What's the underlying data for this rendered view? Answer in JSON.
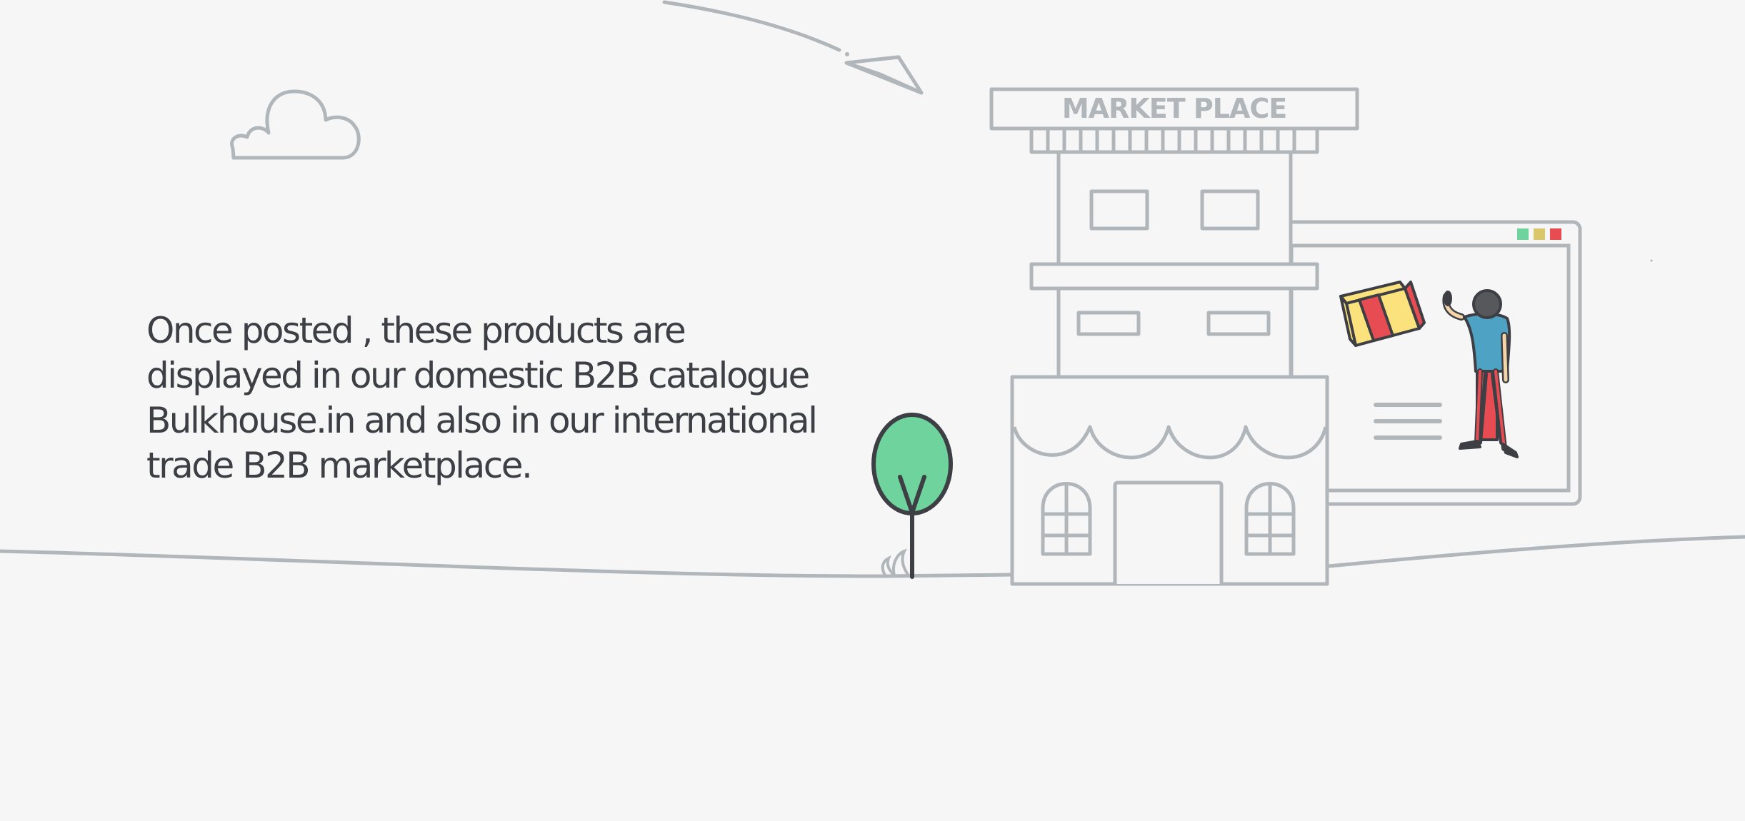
{
  "illustration": {
    "sign_text": "MARKET PLACE",
    "colors": {
      "background": "#f6f6f6",
      "outline": "#b1b6ba",
      "ink": "#3d3f45",
      "tree_green": "#6ed39c",
      "shirt_blue": "#4ea3c4",
      "box_yellow": "#fbe27c",
      "box_red": "#e74c52",
      "window_dot_green": "#6ed39c",
      "window_dot_yellow": "#d9c76a",
      "window_dot_red": "#e74c52"
    },
    "icons": [
      "paper-plane-icon",
      "cloud-icon",
      "tree-icon",
      "storefront-icon",
      "browser-window-icon",
      "person-icon",
      "gift-box-icon"
    ]
  },
  "caption": {
    "lines": [
      "Once posted , these products are",
      "displayed in our domestic B2B catalogue",
      "Bulkhouse.in and also in our international",
      "trade B2B marketplace."
    ]
  }
}
